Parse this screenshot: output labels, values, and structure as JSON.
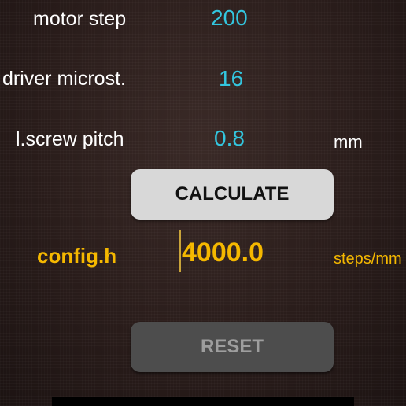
{
  "inputs": {
    "motor_step": {
      "label": "motor step",
      "value": "200"
    },
    "driver_microstep": {
      "label": "driver microst.",
      "value": "16"
    },
    "screw_pitch": {
      "label": "l.screw pitch",
      "value": "0.8",
      "unit": "mm"
    }
  },
  "buttons": {
    "calculate": "CALCULATE",
    "reset": "RESET"
  },
  "result": {
    "label": "config.h",
    "value": "4000.0",
    "unit": "steps/mm"
  },
  "colors": {
    "value_text": "#33c6df",
    "result_text": "#f5b800",
    "calculate_bg": "#d8d8d8",
    "reset_bg": "#4d4d4d"
  }
}
